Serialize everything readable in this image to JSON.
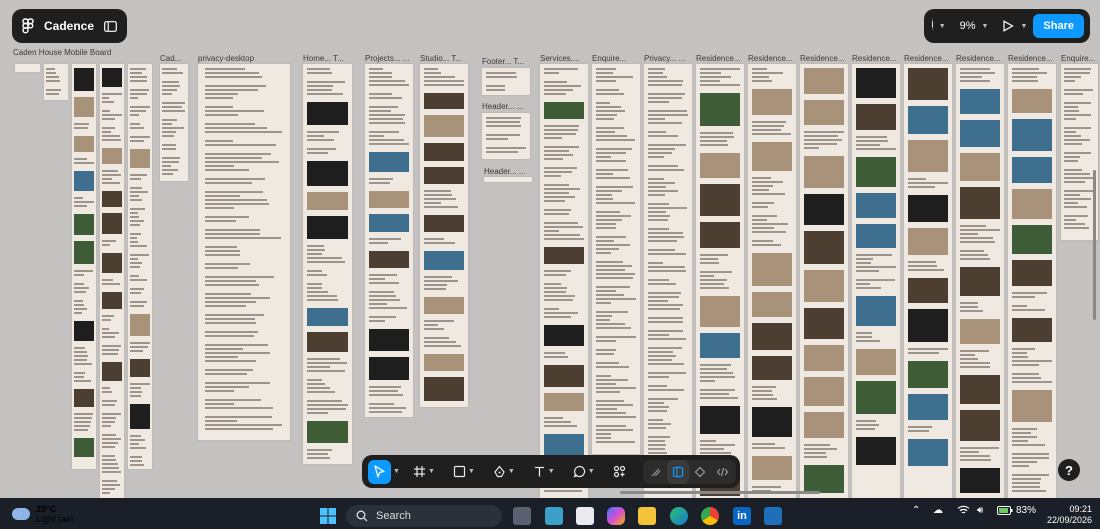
{
  "app": {
    "file_title": "Cadence",
    "zoom": "9%",
    "share_label": "Share"
  },
  "frames": [
    {
      "label": "Caden House Mobile Board"
    },
    {
      "label": "Cad..."
    },
    {
      "label": "privacy-desktop"
    },
    {
      "label": "Home... T..."
    },
    {
      "label": "Projects... ..."
    },
    {
      "label": "Studio... T..."
    },
    {
      "label": "Footer... T..."
    },
    {
      "label": "Header... ..."
    },
    {
      "label": "Header... ..."
    },
    {
      "label": "Services...."
    },
    {
      "label": "Enquire..."
    },
    {
      "label": "Privacy... ..."
    },
    {
      "label": "Residence..."
    },
    {
      "label": "Residence..."
    },
    {
      "label": "Residence..."
    },
    {
      "label": "Residence..."
    },
    {
      "label": "Residence..."
    },
    {
      "label": "Residence..."
    },
    {
      "label": "Residence..."
    },
    {
      "label": "Enquire..."
    }
  ],
  "toolbar": {
    "tools": [
      "move-tool",
      "frame-tool",
      "shape-tool",
      "pen-tool",
      "text-tool",
      "comment-tool",
      "components-tool"
    ],
    "help_label": "?"
  },
  "taskbar": {
    "weather_temp": "25°C",
    "weather_desc": "Light rain",
    "search_placeholder": "Search",
    "battery": "83%",
    "time": "09:21",
    "date": "22/09/2026"
  }
}
